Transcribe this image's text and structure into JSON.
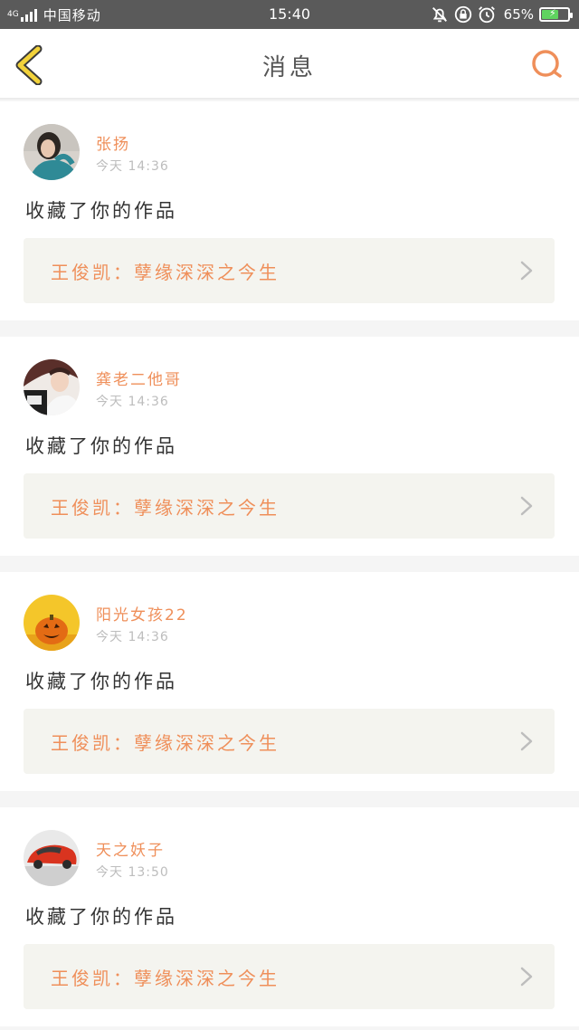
{
  "status_bar": {
    "network": "4G",
    "carrier": "中国移动",
    "time": "15:40",
    "battery_percent": "65%",
    "icons": [
      "bell-off-icon",
      "rotation-lock-icon",
      "alarm-icon",
      "battery-icon"
    ]
  },
  "header": {
    "title": "消息",
    "back_icon": "chevron-left-icon",
    "search_icon": "search-icon"
  },
  "colors": {
    "accent": "#ef8f5a",
    "back_arrow": "#f2d23a",
    "card_link_bg": "#f4f4ef"
  },
  "messages": [
    {
      "user": "张扬",
      "time": "今天 14:36",
      "action": "收藏了你的作品",
      "work": "王俊凯：孽缘深深之今生",
      "avatar": "photo-girl-teal-sweater"
    },
    {
      "user": "龚老二他哥",
      "time": "今天 14:36",
      "action": "收藏了你的作品",
      "work": "王俊凯：孽缘深深之今生",
      "avatar": "photo-boy-with-sign"
    },
    {
      "user": "阳光女孩22",
      "time": "今天 14:36",
      "action": "收藏了你的作品",
      "work": "王俊凯：孽缘深深之今生",
      "avatar": "photo-jack-o-lantern"
    },
    {
      "user": "天之妖子",
      "time": "今天 13:50",
      "action": "收藏了你的作品",
      "work": "王俊凯：孽缘深深之今生",
      "avatar": "photo-red-sports-car"
    }
  ]
}
